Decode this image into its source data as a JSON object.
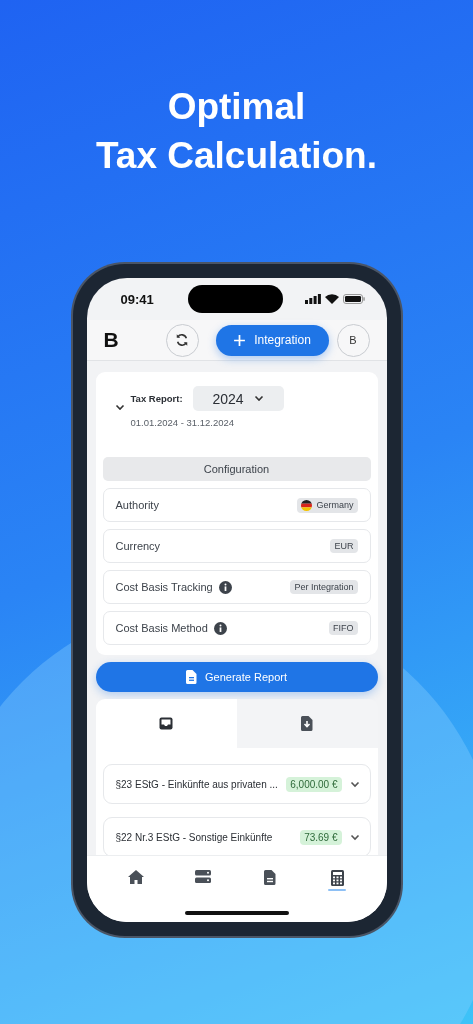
{
  "headline": {
    "line_1": "Optimal",
    "line_2": "Tax Calculation."
  },
  "status_bar": {
    "time": "09:41"
  },
  "header": {
    "logo": "B",
    "integration_button": "Integration",
    "avatar": "B"
  },
  "tax_report": {
    "label": "Tax Report:",
    "year": "2024",
    "period": "01.01.2024 - 31.12.2024"
  },
  "configuration": {
    "title": "Configuration",
    "rows": [
      {
        "label": "Authority",
        "value": "Germany",
        "kind": "country",
        "info": false
      },
      {
        "label": "Currency",
        "value": "EUR",
        "kind": "plain",
        "info": false
      },
      {
        "label": "Cost Basis Tracking",
        "value": "Per Integration",
        "kind": "plain",
        "info": true
      },
      {
        "label": "Cost Basis Method",
        "value": "FIFO",
        "kind": "plain",
        "info": true
      }
    ]
  },
  "generate_button": "Generate Report",
  "tabs": [
    {
      "kind": "inbox",
      "selected": true
    },
    {
      "kind": "download",
      "selected": false
    }
  ],
  "items": [
    {
      "title": "§23 EStG - Einkünfte aus privaten ...",
      "amount": "6,000.00 €",
      "expanded": false
    },
    {
      "title": "§22 Nr.3 EStG - Sonstige Einkünfte",
      "amount": "73.69 €",
      "expanded": false
    }
  ],
  "nav": [
    {
      "kind": "home",
      "selected": false
    },
    {
      "kind": "server",
      "selected": false
    },
    {
      "kind": "document",
      "selected": false
    },
    {
      "kind": "calculator",
      "selected": true
    }
  ]
}
